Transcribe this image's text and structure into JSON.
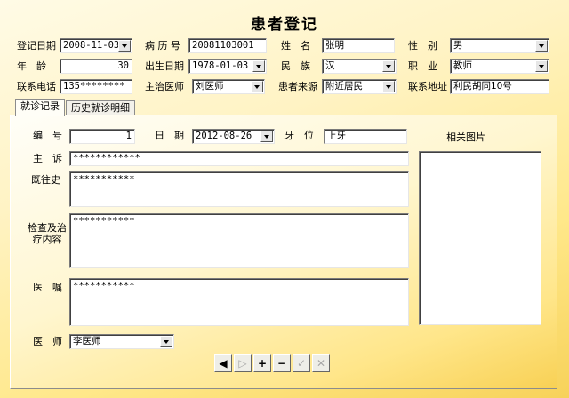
{
  "title": "患者登记",
  "patient": {
    "reg_date_label": "登记日期",
    "reg_date": "2008-11-03",
    "record_no_label": "病 历 号",
    "record_no": "20081103001",
    "name_label": "姓　名",
    "name": "张明",
    "gender_label": "性　别",
    "gender": "男",
    "age_label": "年　龄",
    "age": "30",
    "birth_label": "出生日期",
    "birth": "1978-01-03",
    "ethnicity_label": "民　族",
    "ethnicity": "汉",
    "occupation_label": "职　业",
    "occupation": "教师",
    "phone_label": "联系电话",
    "phone": "135********",
    "doctor_label": "主治医师",
    "doctor": "刘医师",
    "source_label": "患者来源",
    "source": "附近居民",
    "address_label": "联系地址",
    "address": "利民胡同10号"
  },
  "tabs": [
    "就诊记录",
    "历史就诊明细"
  ],
  "visit": {
    "no_label": "编　号",
    "no": "1",
    "date_label": "日　期",
    "date": "2012-08-26",
    "tooth_label": "牙　位",
    "tooth": "上牙",
    "complaint_label": "主　诉",
    "complaint": "************",
    "history_label": "既往史",
    "history": "***********",
    "exam_label": "检查及治疗内容",
    "exam": "***********",
    "advice_label": "医　嘱",
    "advice": "***********",
    "physician_label": "医　师",
    "physician": "李医师",
    "images_label": "相关图片"
  },
  "nav_buttons": [
    "◀",
    "▷",
    "+",
    "−",
    "✓",
    "✕"
  ]
}
